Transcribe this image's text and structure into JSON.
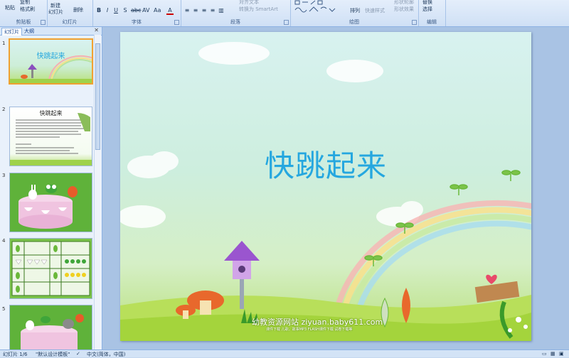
{
  "ribbon": {
    "clipboard": {
      "paste": "粘贴",
      "copy": "复制",
      "format_painter": "格式刷",
      "label": "剪贴板"
    },
    "slides": {
      "new_slide": "新建",
      "new_slide2": "幻灯片",
      "delete": "删除",
      "label": "幻灯片"
    },
    "font": {
      "label": "字体"
    },
    "paragraph": {
      "smartart": "转换为 SmartArt",
      "align_text": "对齐文本",
      "label": "段落"
    },
    "drawing": {
      "arrange": "排列",
      "quick_styles": "快速样式",
      "shape_effects": "形状效果",
      "shape_outline": "形状轮廓",
      "label": "绘图"
    },
    "editing": {
      "replace": "替换",
      "select": "选择",
      "label": "编辑"
    }
  },
  "panel": {
    "tab_slides": "幻灯片",
    "tab_outline": "大纲",
    "thumbs": [
      {
        "num": "1",
        "title": "快跳起来"
      },
      {
        "num": "2",
        "title": "快跳起来"
      },
      {
        "num": "3"
      },
      {
        "num": "4"
      },
      {
        "num": "5"
      }
    ]
  },
  "slide": {
    "title": "快跳起来",
    "site": "幼教资源网站 ziyuan.baby611.com",
    "sub": "课件下载   儿歌、故事MP3   FLASH课件下载   试卷下载等"
  },
  "status": {
    "slide_count": "幻灯片 1/6",
    "theme": "\"默认设计模板\"",
    "language": "中文(简体，中国)"
  },
  "colors": {
    "title": "#25a7df",
    "ribbon": "#dbe7f6",
    "selection": "#f0a030"
  }
}
